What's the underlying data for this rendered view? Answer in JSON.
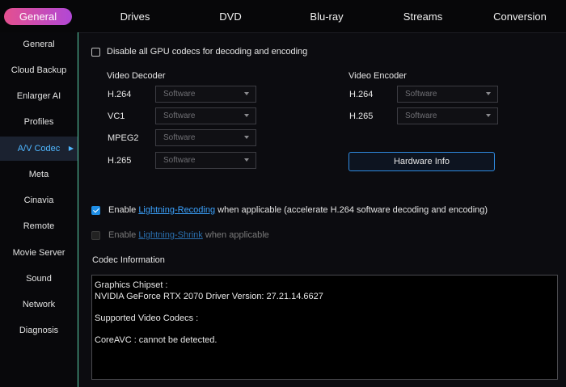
{
  "top_tabs": [
    "General",
    "Drives",
    "DVD",
    "Blu-ray",
    "Streams",
    "Conversion"
  ],
  "sidebar": [
    "General",
    "Cloud Backup",
    "Enlarger AI",
    "Profiles",
    "A/V Codec",
    "Meta",
    "Cinavia",
    "Remote",
    "Movie Server",
    "Sound",
    "Network",
    "Diagnosis"
  ],
  "gpu_checkbox_label": "Disable all GPU codecs for decoding and encoding",
  "video_decoder": {
    "title": "Video Decoder",
    "rows": [
      {
        "label": "H.264",
        "value": "Software"
      },
      {
        "label": "VC1",
        "value": "Software"
      },
      {
        "label": "MPEG2",
        "value": "Software"
      },
      {
        "label": "H.265",
        "value": "Software"
      }
    ]
  },
  "video_encoder": {
    "title": "Video Encoder",
    "rows": [
      {
        "label": "H.264",
        "value": "Software"
      },
      {
        "label": "H.265",
        "value": "Software"
      }
    ]
  },
  "hardware_info_button": "Hardware Info",
  "lightning_recoding": {
    "prefix": "Enable ",
    "link": "Lightning-Recoding",
    "suffix": " when applicable (accelerate H.264 software decoding and encoding)"
  },
  "lightning_shrink": {
    "prefix": "Enable ",
    "link": "Lightning-Shrink",
    "suffix": " when applicable"
  },
  "codec_info_title": "Codec Information",
  "codec_info_lines": [
    "Graphics Chipset :",
    "NVIDIA GeForce RTX 2070 Driver Version: 27.21.14.6627",
    "",
    "Supported Video Codecs :",
    "",
    "CoreAVC : cannot be detected."
  ],
  "colors": {
    "accent_gradient_start": "#e4508f",
    "accent_gradient_end": "#b148d6",
    "link": "#3ba3ff",
    "sidebar_divider": "#5ad0a8",
    "checkbox_checked": "#1e8ee6"
  }
}
